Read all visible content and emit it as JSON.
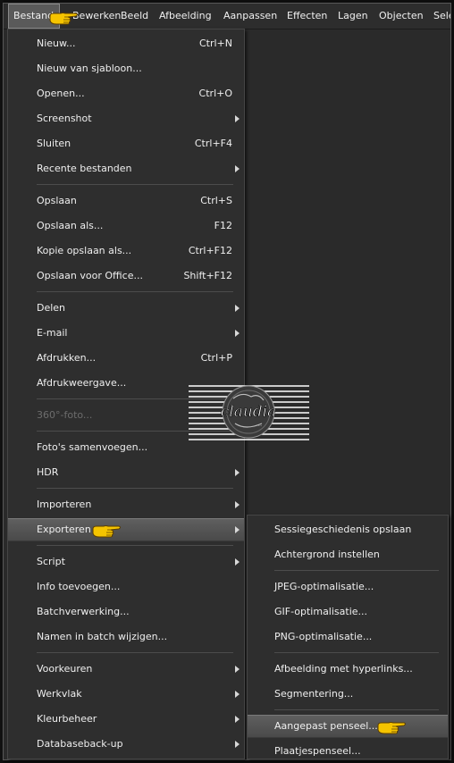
{
  "menubar": {
    "items": [
      {
        "label": "Bestand"
      },
      {
        "label": "Bewerken"
      },
      {
        "label": "Beeld"
      },
      {
        "label": "Afbeelding"
      },
      {
        "label": "Aanpassen"
      },
      {
        "label": "Effecten"
      },
      {
        "label": "Lagen"
      },
      {
        "label": "Objecten"
      },
      {
        "label": "Selecties"
      }
    ]
  },
  "file_menu": {
    "items": [
      {
        "label": "Nieuw...",
        "shortcut": "Ctrl+N"
      },
      {
        "label": "Nieuw van sjabloon...",
        "shortcut": ""
      },
      {
        "label": "Openen...",
        "shortcut": "Ctrl+O"
      },
      {
        "label": "Screenshot",
        "shortcut": ""
      },
      {
        "label": "Sluiten",
        "shortcut": "Ctrl+F4"
      },
      {
        "label": "Recente bestanden",
        "shortcut": ""
      },
      {
        "label": "Opslaan",
        "shortcut": "Ctrl+S"
      },
      {
        "label": "Opslaan als...",
        "shortcut": "F12"
      },
      {
        "label": "Kopie opslaan als...",
        "shortcut": "Ctrl+F12"
      },
      {
        "label": "Opslaan voor Office...",
        "shortcut": "Shift+F12"
      },
      {
        "label": "Delen",
        "shortcut": ""
      },
      {
        "label": "E-mail",
        "shortcut": ""
      },
      {
        "label": "Afdrukken...",
        "shortcut": "Ctrl+P"
      },
      {
        "label": "Afdrukweergave...",
        "shortcut": ""
      },
      {
        "label": "360°-foto...",
        "shortcut": ""
      },
      {
        "label": "Foto's samenvoegen...",
        "shortcut": ""
      },
      {
        "label": "HDR",
        "shortcut": ""
      },
      {
        "label": "Importeren",
        "shortcut": ""
      },
      {
        "label": "Exporteren",
        "shortcut": ""
      },
      {
        "label": "Script",
        "shortcut": ""
      },
      {
        "label": "Info toevoegen...",
        "shortcut": ""
      },
      {
        "label": "Batchverwerking...",
        "shortcut": ""
      },
      {
        "label": "Namen in batch wijzigen...",
        "shortcut": ""
      },
      {
        "label": "Voorkeuren",
        "shortcut": ""
      },
      {
        "label": "Werkvlak",
        "shortcut": ""
      },
      {
        "label": "Kleurbeheer",
        "shortcut": ""
      },
      {
        "label": "Databaseback-up",
        "shortcut": ""
      }
    ]
  },
  "export_submenu": {
    "items": [
      {
        "label": "Sessiegeschiedenis opslaan"
      },
      {
        "label": "Achtergrond instellen"
      },
      {
        "label": "JPEG-optimalisatie..."
      },
      {
        "label": "GIF-optimalisatie..."
      },
      {
        "label": "PNG-optimalisatie..."
      },
      {
        "label": "Afbeelding met hyperlinks..."
      },
      {
        "label": "Segmentering..."
      },
      {
        "label": "Aangepast penseel..."
      },
      {
        "label": "Plaatjespenseel..."
      }
    ]
  },
  "watermark": {
    "text": "claudia",
    "subtext": "..."
  },
  "colors": {
    "menu_bg": "#2e2e2e",
    "highlight": "#555555",
    "pointer_hand": "#f5c400"
  },
  "icons": {
    "pointer": "pointing-hand-icon",
    "submenu": "chevron-right-icon"
  }
}
